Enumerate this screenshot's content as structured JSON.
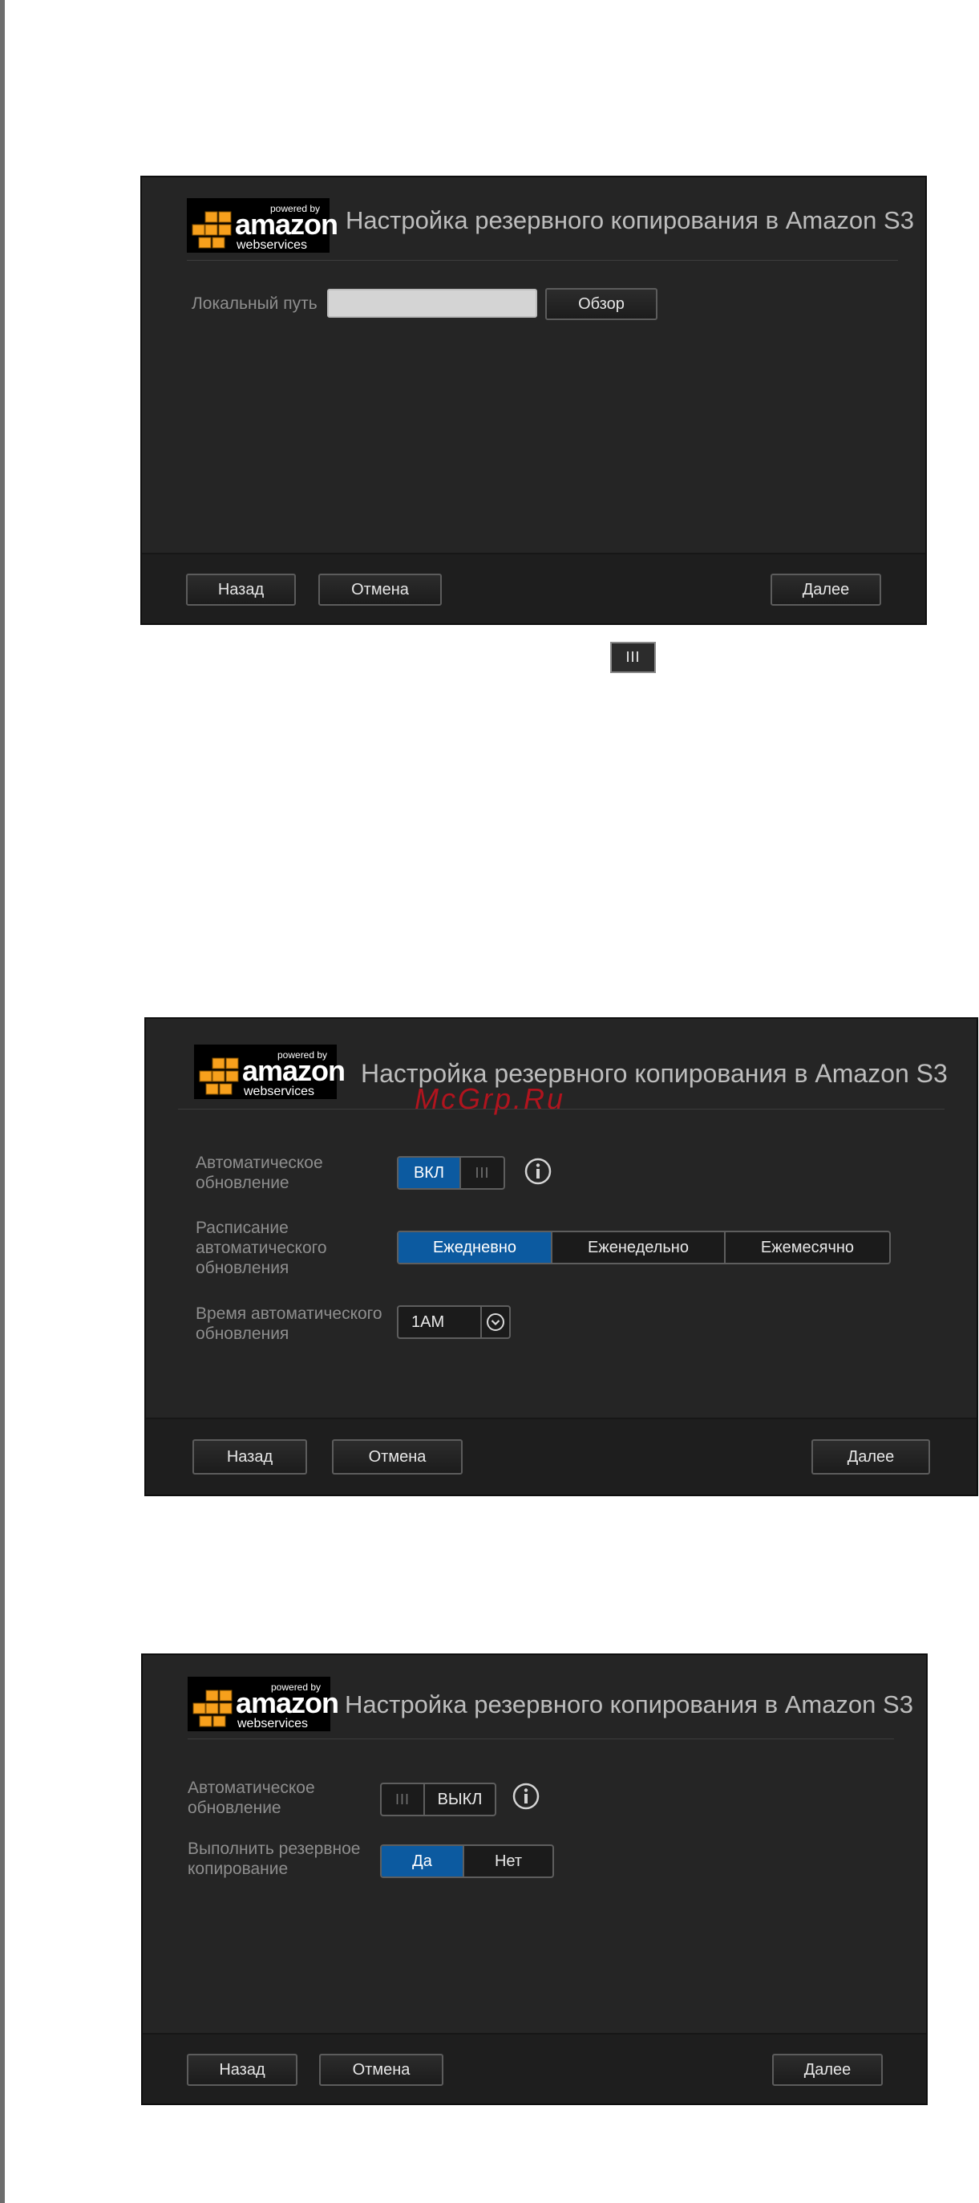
{
  "logo": {
    "powered_by": "powered by",
    "amazon": "amazon",
    "web_services": "webservices"
  },
  "watermark": "McGrp.Ru",
  "icons": {
    "grip": "III",
    "info": "info-icon",
    "chevron": "chevron-down-icon"
  },
  "colors": {
    "dialog_bg": "#252525",
    "footer_bg": "#1e1e1e",
    "accent_blue": "#0c5aa0",
    "logo_orange": "#f7a01c",
    "title_text": "#bdbdbd"
  },
  "dialog1": {
    "title": "Настройка резервного копирования в Amazon S3",
    "local_path_label": "Локальный путь",
    "local_path_value": "",
    "browse_label": "Обзор",
    "back_label": "Назад",
    "cancel_label": "Отмена",
    "next_label": "Далее"
  },
  "dialog2": {
    "title": "Настройка резервного копирования в Amazon S3",
    "auto_update_label": "Автоматическое обновление",
    "auto_update_state": "ВКЛ",
    "schedule_label": "Расписание автоматического обновления",
    "schedule_options": [
      "Ежедневно",
      "Еженедельно",
      "Ежемесячно"
    ],
    "schedule_selected": "Ежедневно",
    "time_label": "Время автоматического обновления",
    "time_value": "1AM",
    "back_label": "Назад",
    "cancel_label": "Отмена",
    "next_label": "Далее"
  },
  "dialog3": {
    "title": "Настройка резервного копирования в Amazon S3",
    "auto_update_label": "Автоматическое обновление",
    "auto_update_state": "ВЫКЛ",
    "run_backup_label": "Выполнить резервное копирование",
    "run_backup_options": [
      "Да",
      "Нет"
    ],
    "run_backup_selected": "Да",
    "back_label": "Назад",
    "cancel_label": "Отмена",
    "next_label": "Далее"
  }
}
